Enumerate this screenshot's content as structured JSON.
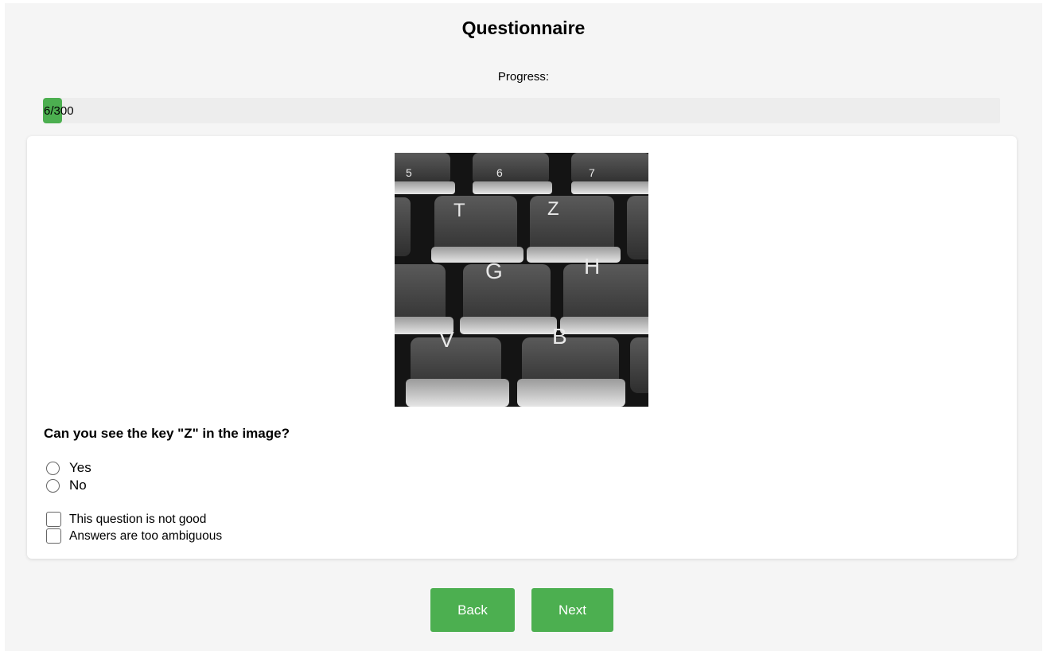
{
  "title": "Questionnaire",
  "progress": {
    "label": "Progress:",
    "text": "6/300",
    "current": 6,
    "total": 300,
    "fill_color": "#4caf50"
  },
  "image": {
    "keys": [
      "5",
      "6",
      "7",
      "T",
      "Z",
      "G",
      "H",
      "V",
      "B"
    ]
  },
  "question": {
    "text": "Can you see the key \"Z\" in the image?",
    "options": [
      "Yes",
      "No"
    ],
    "flags": [
      "This question is not good",
      "Answers are too ambiguous"
    ]
  },
  "buttons": {
    "back": "Back",
    "next": "Next"
  },
  "colors": {
    "accent": "#4caf50",
    "page_bg": "#f5f5f5",
    "card_bg": "#ffffff"
  }
}
